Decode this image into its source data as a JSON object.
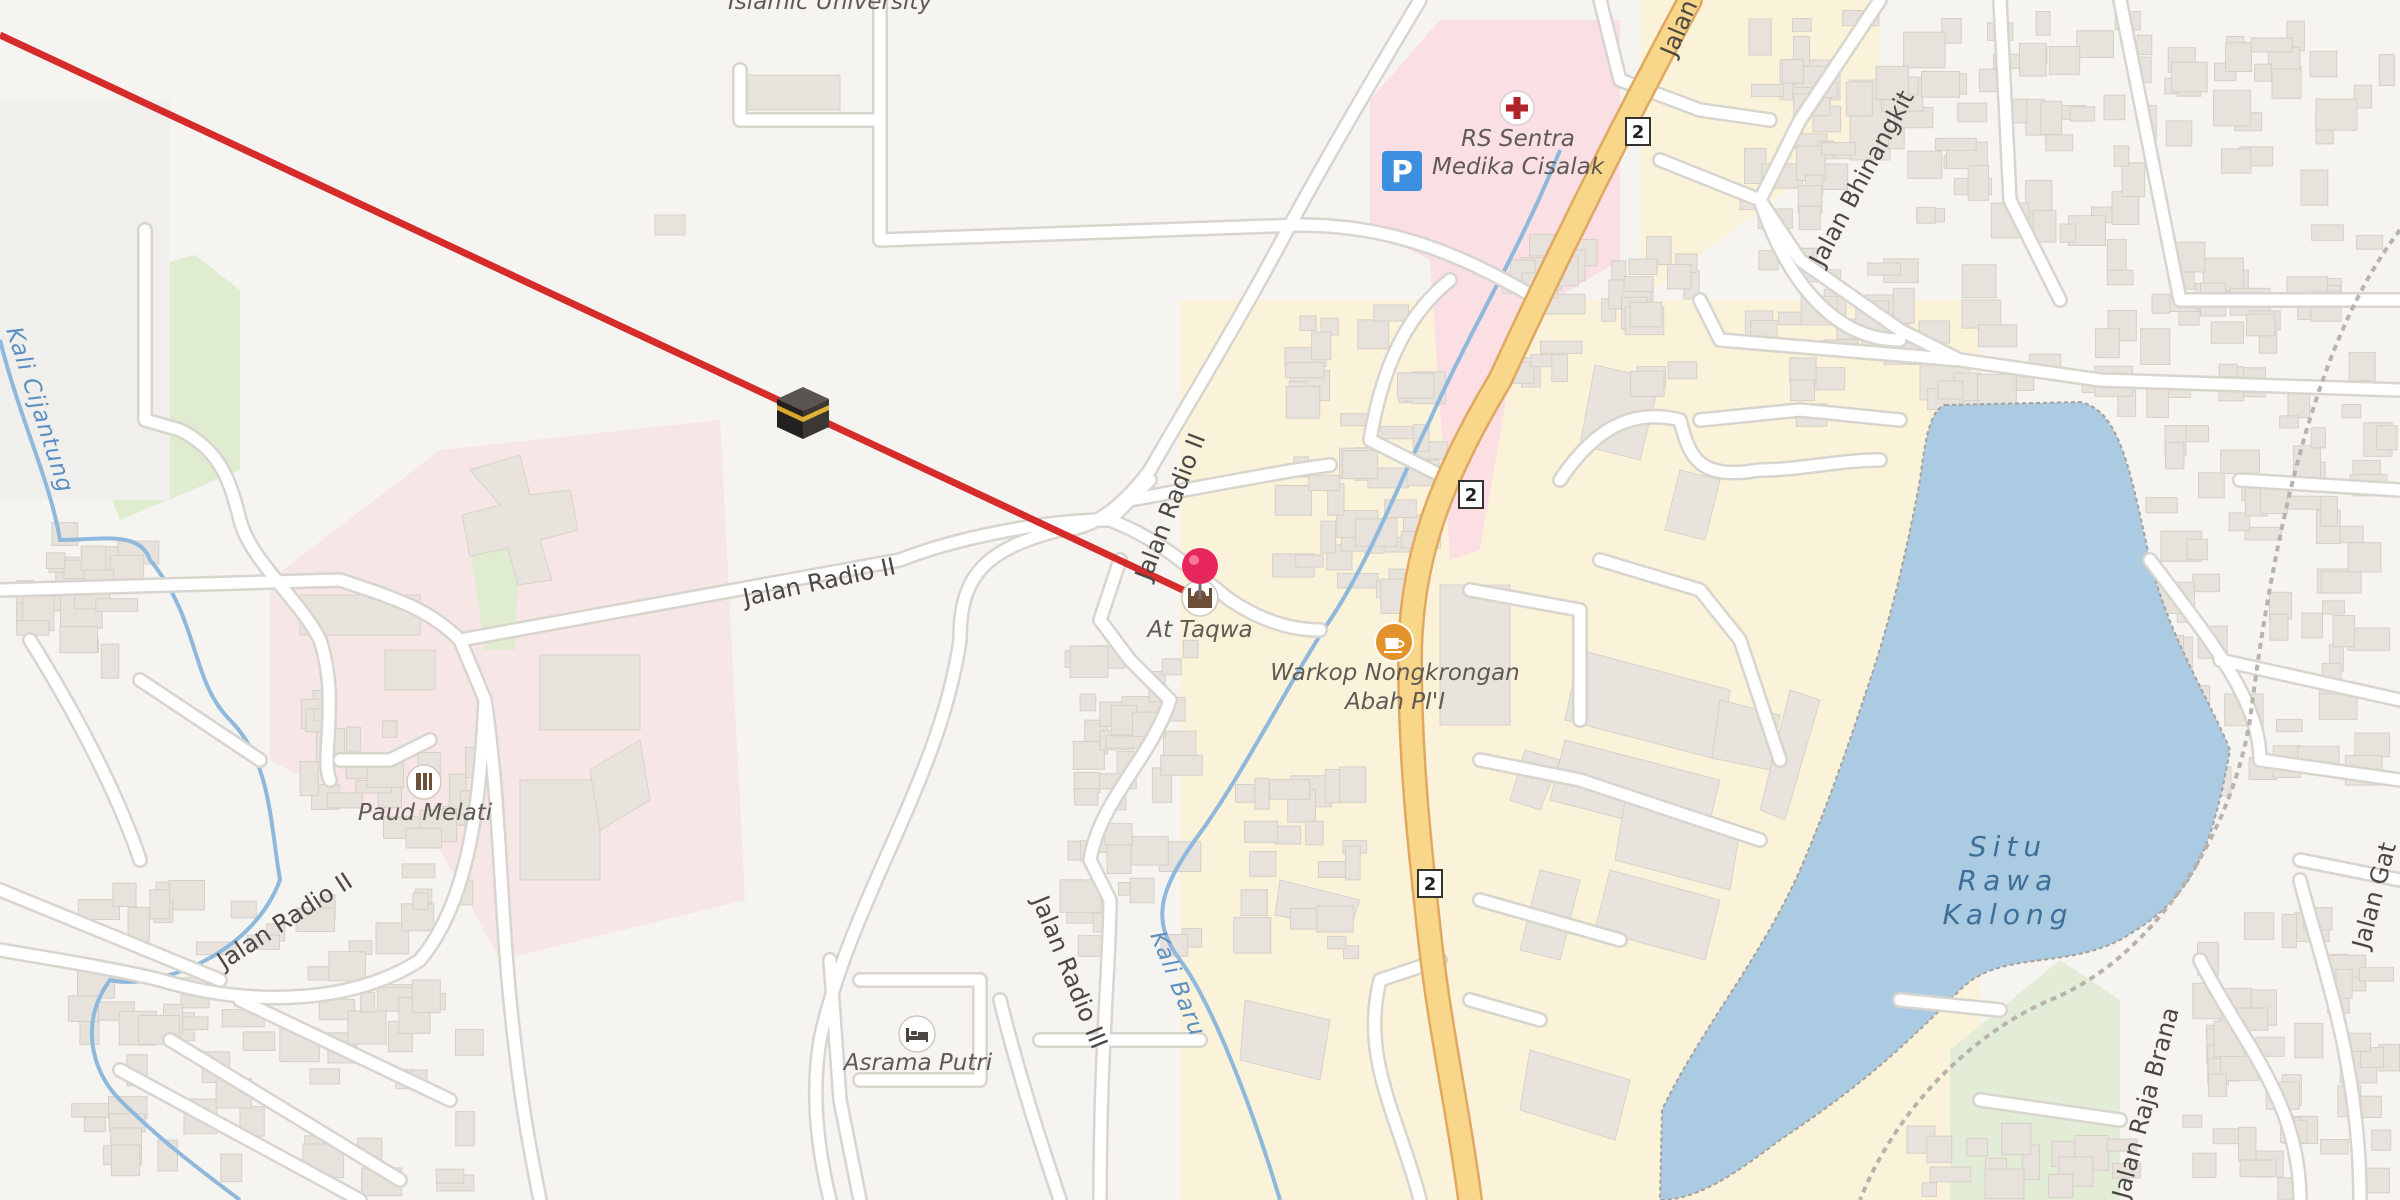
{
  "map": {
    "colors": {
      "background": "#f6f4f1",
      "road": "#ffffff",
      "road_casing": "#dcd8d3",
      "primary_road": "#f8d78a",
      "primary_casing": "#e0a860",
      "water": "#aacbe1",
      "stream": "#8fb8dd",
      "qibla_line": "#d52b2b",
      "pin": "#e8265e",
      "hospital_area": "#fadbe3",
      "residential_yellow": "#fbf3d9",
      "school_area": "#f6e2e2",
      "park": "#dfeccf",
      "building": "#e8e3dd"
    },
    "icons": {
      "kaaba": "kaaba-icon",
      "pin": "location-pin-icon",
      "mosque": "mosque-icon",
      "hospital": "hospital-cross-icon",
      "parking": "parking-icon",
      "cafe": "coffee-cup-icon",
      "school": "school-icon",
      "lodging": "bed-icon"
    },
    "pois": {
      "university": "Islamic University",
      "hospital": [
        "RS Sentra",
        "Medika Cisalak"
      ],
      "parking": "P",
      "mosque": "At Taqwa",
      "cafe": [
        "Warkop Nongkrongan",
        "Abah PI'I"
      ],
      "school": "Paud Melati",
      "dorm": "Asrama Putri"
    },
    "roads": {
      "radio2_west": "Jalan Radio II",
      "radio2_mid": "Jalan Radio II",
      "radio2_north": "Jalan Radio II",
      "radio3": "Jalan Radio III",
      "bhinangkit": "Jalan Bhinangkit",
      "jalan_top": "Jalan",
      "raja_brana": "Jalan Raja Brana",
      "jalan_gat": "Jalan Gat"
    },
    "waterways": {
      "kali_baru": "Kali Baru",
      "kali_cijantung": "Kali Cijantung"
    },
    "lake": [
      "Situ",
      "Rawa",
      "Kalong"
    ],
    "route_shields": [
      "2",
      "2",
      "2"
    ]
  }
}
